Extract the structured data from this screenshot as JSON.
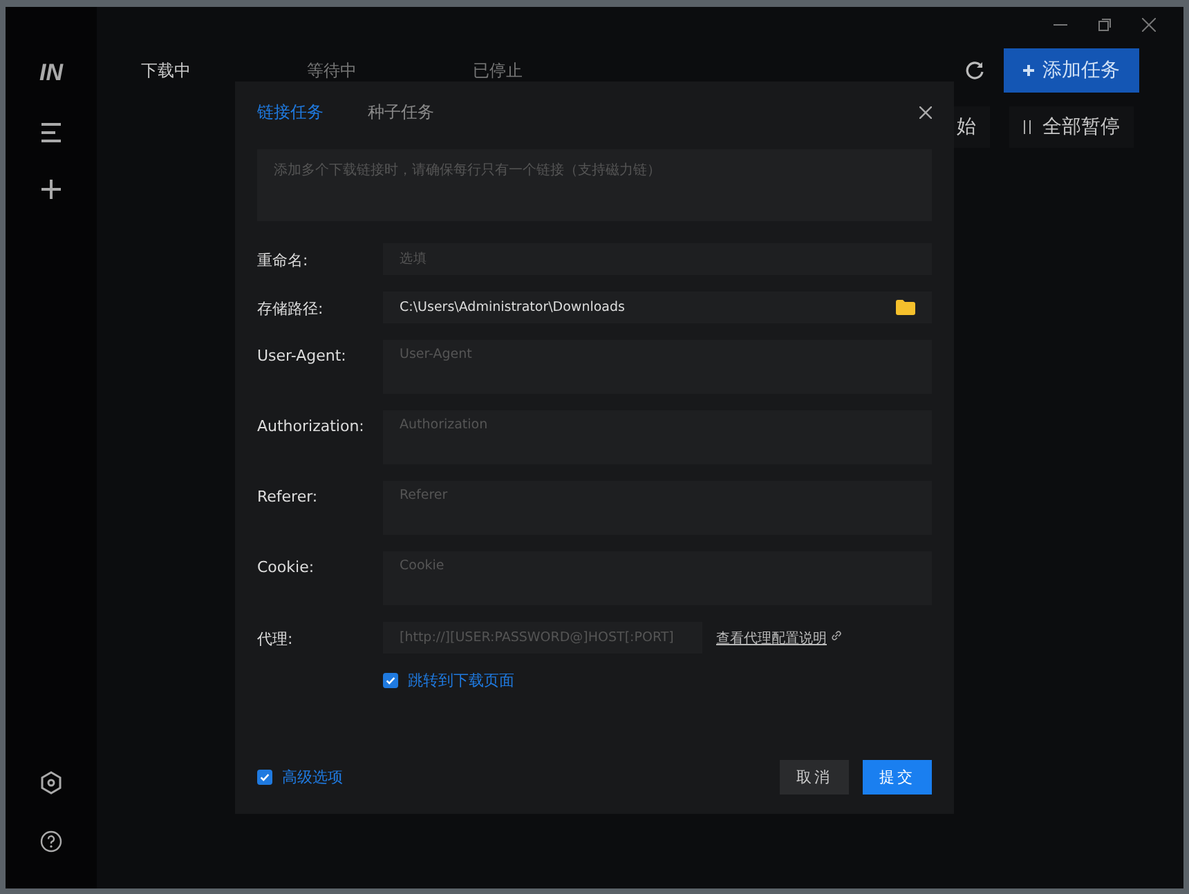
{
  "sidebar": {
    "logo": "IN"
  },
  "tabs": [
    {
      "label": "下载中",
      "selected": true
    },
    {
      "label": "等待中",
      "selected": false
    },
    {
      "label": "已停止",
      "selected": false
    }
  ],
  "toolbar": {
    "add_button": "添加任务",
    "start_all": "始",
    "pause_all": "全部暂停"
  },
  "dialog": {
    "tabs": [
      {
        "label": "链接任务",
        "selected": true
      },
      {
        "label": "种子任务",
        "selected": false
      }
    ],
    "links_placeholder": "添加多个下载链接时，请确保每行只有一个链接（支持磁力链）",
    "fields": [
      {
        "kind": "single",
        "label": "重命名:",
        "placeholder": "选填"
      },
      {
        "kind": "path",
        "label": "存储路径:",
        "value": "C:\\Users\\Administrator\\Downloads"
      },
      {
        "kind": "multi",
        "label": "User-Agent:",
        "placeholder": "User-Agent"
      },
      {
        "kind": "multi",
        "label": "Authorization:",
        "placeholder": "Authorization"
      },
      {
        "kind": "multi",
        "label": "Referer:",
        "placeholder": "Referer"
      },
      {
        "kind": "multi",
        "label": "Cookie:",
        "placeholder": "Cookie"
      },
      {
        "kind": "proxy",
        "label": "代理:",
        "placeholder": "[http://][USER:PASSWORD@]HOST[:PORT]",
        "link": "查看代理配置说明"
      }
    ],
    "jump_option": {
      "label": "跳转到下载页面",
      "checked": true
    },
    "advanced_option": {
      "label": "高级选项",
      "checked": true
    },
    "cancel": "取消",
    "submit": "提交"
  }
}
